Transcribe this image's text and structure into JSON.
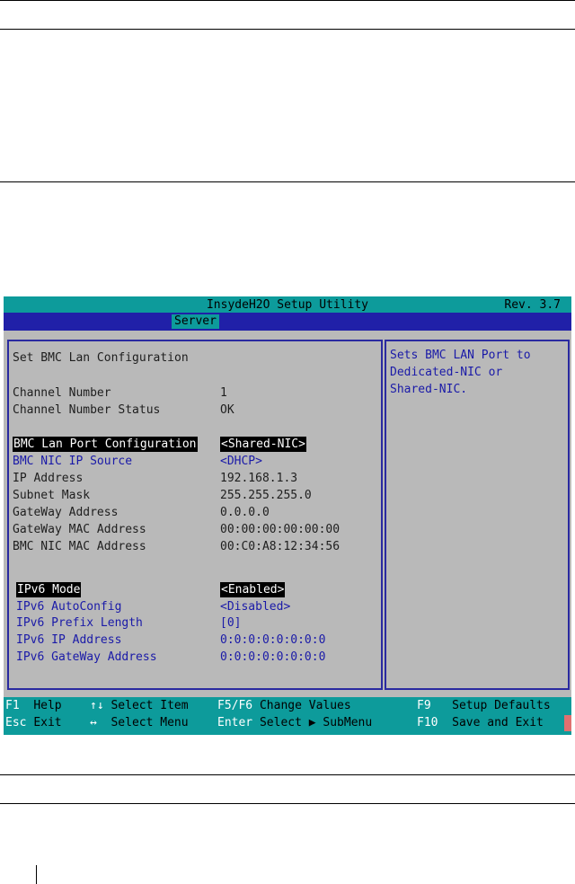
{
  "bios": {
    "title": "InsydeH2O Setup Utility",
    "rev": "Rev. 3.7",
    "menu_tab": "Server",
    "heading": "Set BMC Lan Configuration",
    "channel_number": {
      "label": "Channel Number",
      "value": "1"
    },
    "channel_status": {
      "label": "Channel Number Status",
      "value": "OK"
    },
    "lan_port": {
      "label": "BMC Lan Port Configuration",
      "value": "<Shared-NIC>"
    },
    "ip_source": {
      "label": "BMC NIC IP Source",
      "value": "<DHCP>"
    },
    "ip_address": {
      "label": "IP Address",
      "value": "192.168.1.3"
    },
    "subnet_mask": {
      "label": "Subnet Mask",
      "value": "255.255.255.0"
    },
    "gateway_address": {
      "label": "GateWay Address",
      "value": "0.0.0.0"
    },
    "gateway_mac": {
      "label": "GateWay MAC Address",
      "value": "00:00:00:00:00:00"
    },
    "nic_mac": {
      "label": "BMC NIC MAC Address",
      "value": "00:C0:A8:12:34:56"
    },
    "ipv6_mode": {
      "label": "IPv6 Mode",
      "value": "<Enabled>"
    },
    "ipv6_autoconfig": {
      "label": "IPv6 AutoConfig",
      "value": "<Disabled>"
    },
    "ipv6_prefix": {
      "label": "IPv6 Prefix Length",
      "value": "[0]"
    },
    "ipv6_ip": {
      "label": "IPv6 IP Address",
      "value": "0:0:0:0:0:0:0:0"
    },
    "ipv6_gateway": {
      "label": "IPv6 GateWay Address",
      "value": "0:0:0:0:0:0:0:0"
    },
    "help_text": "Sets BMC LAN Port to\nDedicated-NIC or\nShared-NIC."
  },
  "footer": {
    "f1_key": "F1",
    "f1_label": "Help",
    "arrows_ud_key": "↑↓",
    "arrows_ud_label": "Select Item",
    "f5f6_key": "F5/F6",
    "f5f6_label": "Change Values",
    "f9_key": "F9",
    "f9_label": "Setup Defaults",
    "esc_key": "Esc",
    "esc_label": "Exit",
    "arrows_lr_key": "↔",
    "arrows_lr_label": "Select Menu",
    "enter_key": "Enter",
    "enter_label": "Select ▶ SubMenu",
    "f10_key": "F10",
    "f10_label": "Save and Exit"
  },
  "colors": {
    "title_bar": "#0d9b9b",
    "menu_bar": "#2020a8",
    "panel_bg": "#b9b9b9",
    "highlight_text": "#1a1aa8"
  }
}
